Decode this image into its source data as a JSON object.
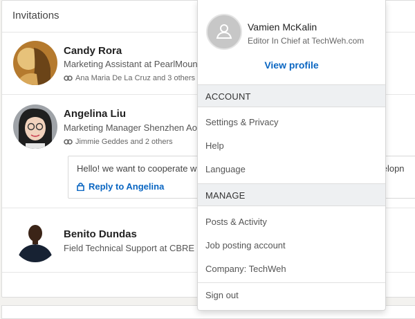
{
  "invitations": {
    "title": "Invitations",
    "items": [
      {
        "name": "Candy Rora",
        "title": "Marketing Assistant at PearlMoun",
        "mutual": "Ana Maria De La Cruz and 3 others"
      },
      {
        "name": "Angelina Liu",
        "title": "Marketing Manager Shenzhen Ao",
        "mutual": "Jimmie Geddes and 2 others",
        "message": "Hello! we want to cooperate w",
        "message_cut": "evelopn",
        "reply_label": "Reply to Angelina"
      },
      {
        "name": "Benito Dundas",
        "title": "Field Technical Support at CBRE"
      }
    ]
  },
  "menu": {
    "user_name": "Vamien McKalin",
    "user_title": "Editor In Chief at TechWeh.com",
    "view_profile": "View profile",
    "account_header": "ACCOUNT",
    "account_items": [
      "Settings & Privacy",
      "Help",
      "Language"
    ],
    "manage_header": "MANAGE",
    "manage_items": [
      "Posts & Activity",
      "Job posting account",
      "Company: TechWeh"
    ],
    "sign_out": "Sign out"
  },
  "colors": {
    "accent": "#0a66c2",
    "section_bg": "#eef0f2"
  }
}
